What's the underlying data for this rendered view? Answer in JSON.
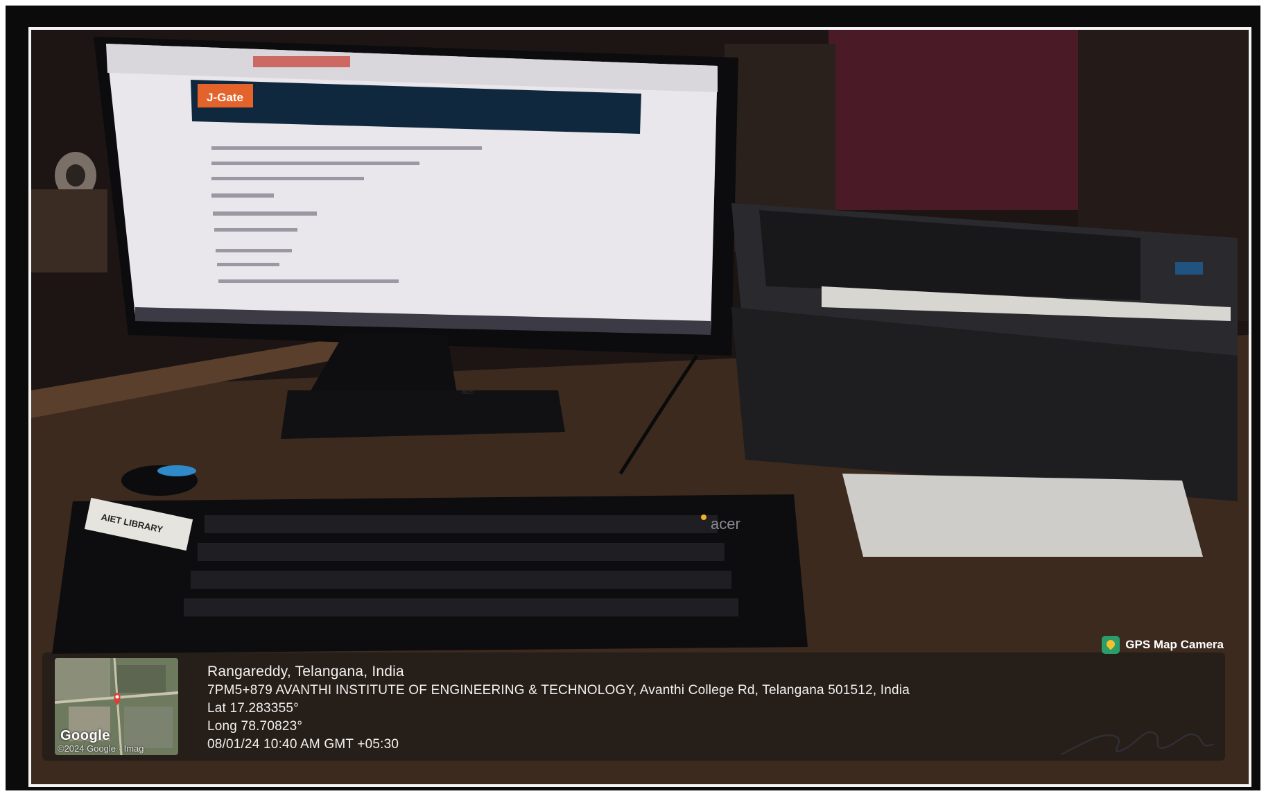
{
  "photo": {
    "screen_logo": "J-Gate",
    "monitor_brand": "acer",
    "keyboard_sticker": "AIET LIBRARY"
  },
  "stamp": {
    "app_name": "GPS Map Camera",
    "place": "Rangareddy, Telangana, India",
    "address": "7PM5+879 AVANTHI INSTITUTE OF ENGINEERING & TECHNOLOGY, Avanthi College Rd, Telangana 501512, India",
    "lat": "Lat 17.283355°",
    "long": "Long 78.70823°",
    "datetime": "08/01/24 10:40 AM GMT +05:30",
    "map_logo": "Google",
    "map_copyright": "©2024 Google · Imag"
  },
  "colors": {
    "frame": "#0b0b0b",
    "border": "#f4f4f4",
    "screen": "#e9e7ec",
    "jgate_bar": "#10283d",
    "jgate_logo": "#e4632a",
    "wall_maroon": "#4a1a26",
    "desk": "#3c2a1e"
  }
}
